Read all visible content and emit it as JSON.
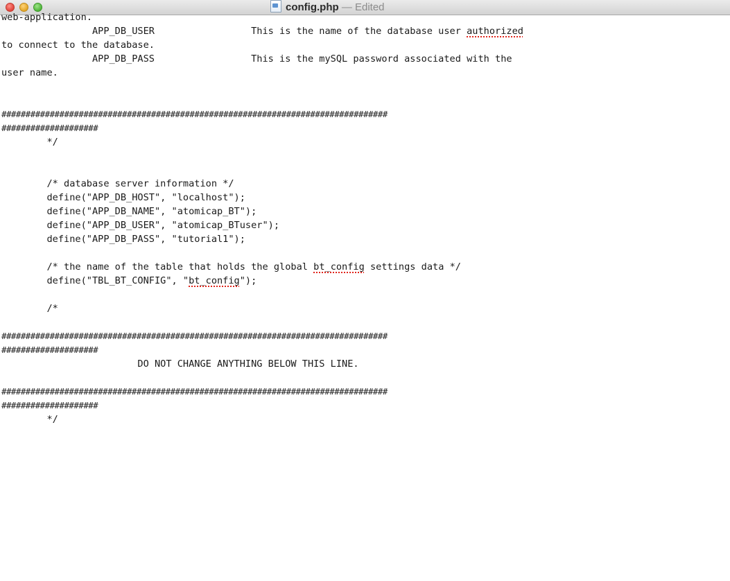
{
  "window": {
    "title": "config.php",
    "edited": "— Edited"
  },
  "editor": {
    "lines": [
      "web-application.",
      "                APP_DB_USER                 This is the name of the database user authorized",
      "to connect to the database.",
      "                APP_DB_PASS                 This is the mySQL password associated with the",
      "user name.",
      "",
      "",
      "################################################################################",
      "####################",
      "        */",
      "",
      "",
      "        /* database server information */",
      "        define(\"APP_DB_HOST\", \"localhost\");",
      "        define(\"APP_DB_NAME\", \"atomicap_BT\");",
      "        define(\"APP_DB_USER\", \"atomicap_BTuser\");",
      "        define(\"APP_DB_PASS\", \"tutorial1\");",
      "",
      "        /* the name of the table that holds the global bt_config settings data */",
      "        define(\"TBL_BT_CONFIG\", \"bt_config\");",
      "",
      "        /*",
      "",
      "################################################################################",
      "####################",
      "                        DO NOT CHANGE ANYTHING BELOW THIS LINE.",
      "",
      "################################################################################",
      "####################",
      "        */"
    ],
    "spelling_errors": [
      "authorized",
      "bt_config",
      "bt_config"
    ]
  }
}
